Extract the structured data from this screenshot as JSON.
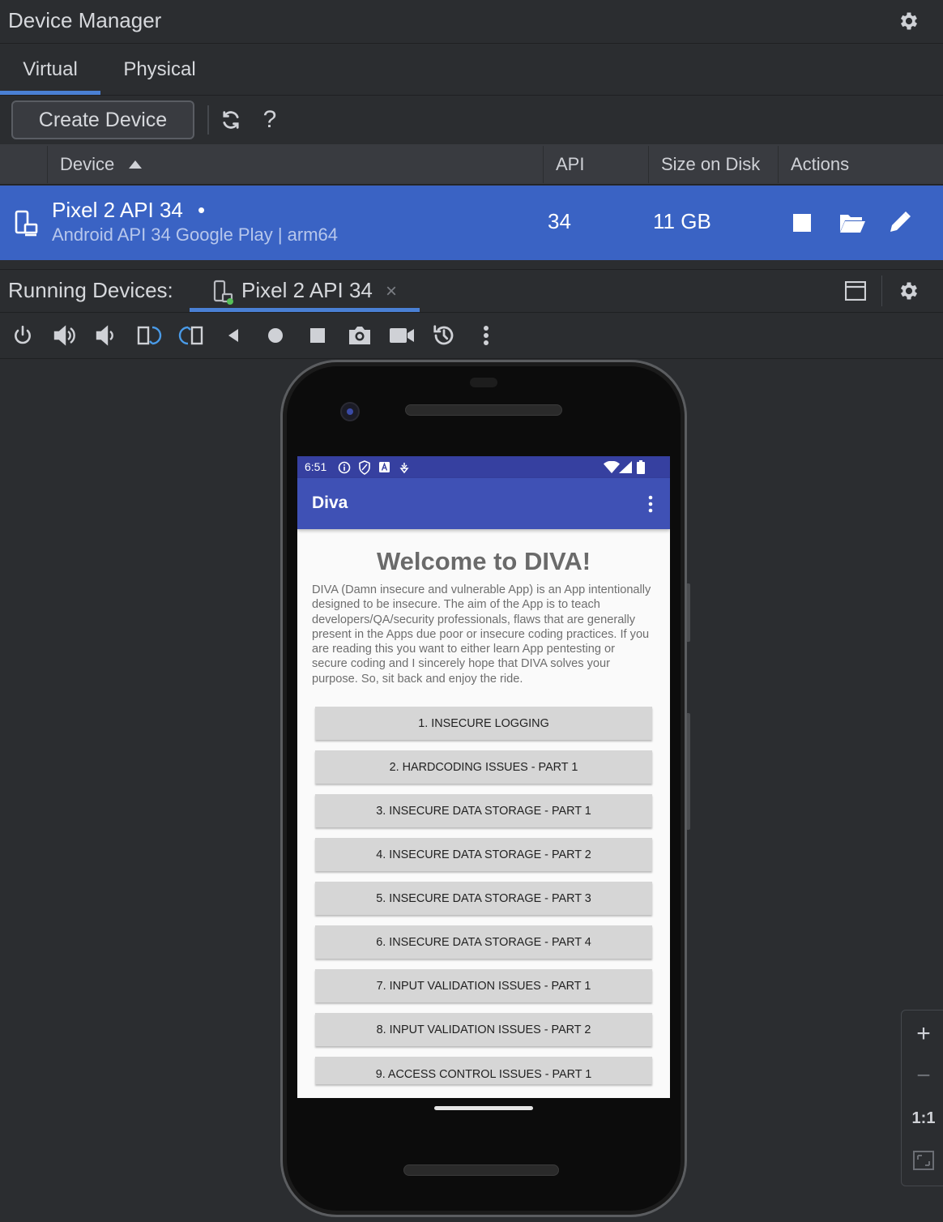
{
  "window": {
    "title": "Device Manager"
  },
  "tabs": [
    {
      "label": "Virtual",
      "active": true
    },
    {
      "label": "Physical",
      "active": false
    }
  ],
  "toolbar": {
    "create_label": "Create Device",
    "help_label": "?"
  },
  "table": {
    "headers": {
      "device": "Device",
      "api": "API",
      "size": "Size on Disk",
      "actions": "Actions"
    },
    "sort_column": "Device",
    "rows": [
      {
        "name": "Pixel 2 API 34",
        "status_dot": "•",
        "subtitle": "Android API 34 Google Play | arm64",
        "api": "34",
        "size": "11 GB",
        "selected": true
      }
    ]
  },
  "running": {
    "label": "Running Devices:",
    "tab_label": "Pixel 2 API 34",
    "close_label": "×"
  },
  "emulator_toolbar": [
    "power-icon",
    "volume-up-icon",
    "volume-down-icon",
    "rotate-left-icon",
    "rotate-right-icon",
    "back-icon",
    "home-icon",
    "overview-icon",
    "screenshot-icon",
    "screen-record-icon",
    "snapshot-icon",
    "more-icon"
  ],
  "phone_screen": {
    "status_time": "6:51",
    "app_title": "Diva",
    "welcome": "Welcome to DIVA!",
    "description": "DIVA (Damn insecure and vulnerable App) is an App intentionally designed to be insecure. The aim of the App is to teach developers/QA/security professionals, flaws that are generally present in the Apps due poor or insecure coding practices. If you are reading this you want to either learn App pentesting or secure coding and I sincerely hope that DIVA solves your purpose. So, sit back and enjoy the ride.",
    "buttons": [
      "1. INSECURE LOGGING",
      "2. HARDCODING ISSUES - PART 1",
      "3. INSECURE DATA STORAGE - PART 1",
      "4. INSECURE DATA STORAGE - PART 2",
      "5. INSECURE DATA STORAGE - PART 3",
      "6. INSECURE DATA STORAGE - PART 4",
      "7. INPUT VALIDATION ISSUES - PART 1",
      "8. INPUT VALIDATION ISSUES - PART 2",
      "9. ACCESS CONTROL ISSUES - PART 1"
    ]
  },
  "zoom": {
    "plus": "+",
    "minus": "−",
    "actual": "1:1"
  },
  "colors": {
    "selection": "#3a63c4",
    "accent": "#4a80d4",
    "app_bar": "#3f51b5",
    "status_bar": "#3640a0"
  }
}
